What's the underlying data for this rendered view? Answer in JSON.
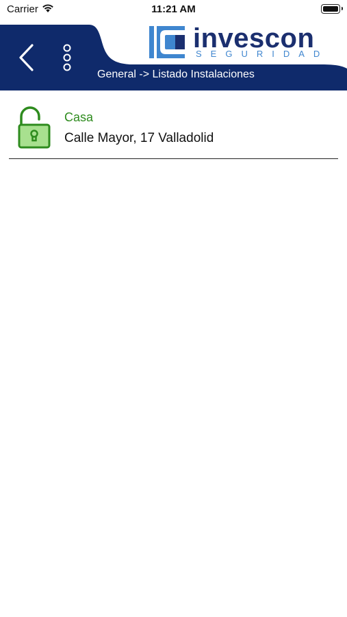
{
  "status_bar": {
    "carrier": "Carrier",
    "time": "11:21 AM"
  },
  "header": {
    "logo_name": "invescon",
    "logo_sub": "SEGURIDAD",
    "breadcrumb": "General -> Listado Instalaciones",
    "color": "#0f2a6b"
  },
  "installations": [
    {
      "name": "Casa",
      "address": "Calle Mayor, 17 Valladolid",
      "icon": "unlocked-padlock-icon",
      "status_color": "#2e8b1e"
    }
  ]
}
